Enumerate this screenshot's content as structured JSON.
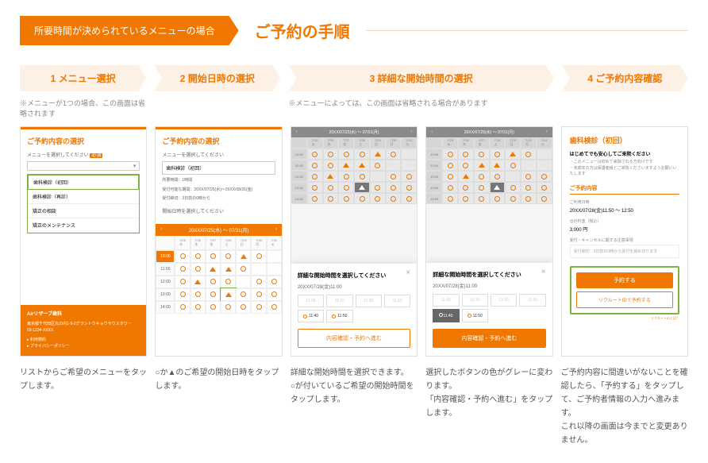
{
  "header": {
    "badge": "所要時間が決められているメニューの場合",
    "title": "ご予約の手順"
  },
  "steps": [
    {
      "num": "1",
      "label": "メニュー選択",
      "note": "※メニューが1つの場合、この画面は省略されます"
    },
    {
      "num": "2",
      "label": "開始日時の選択",
      "note": ""
    },
    {
      "num": "3",
      "label": "詳細な開始時間の選択",
      "note": "※メニューによっては、この画面は省略される場合があります",
      "wide": true
    },
    {
      "num": "4",
      "label": "ご予約内容確認",
      "note": ""
    }
  ],
  "mock1": {
    "title": "ご予約内容の選択",
    "label": "メニューを選択してください",
    "required": "必須",
    "items": [
      "歯科検診（初回）",
      "歯科検診（再診）",
      "矯正の相談",
      "矯正のメンテナンス"
    ],
    "clinic": "Airリザーブ歯科",
    "addr": "東京都千代田区丸の内1-9-2グラントウキョウサウスタワー",
    "tel": "03-1234-XXXX",
    "links": [
      "利用規約",
      "プライバシーポリシー"
    ]
  },
  "mock2": {
    "title": "ご予約内容の選択",
    "label": "メニューを選択してください",
    "menu": "歯科検診（初回）",
    "info": [
      "所要時間：1時間",
      "受付可能な期間：20XX/07/25(水)～20XX/08/31(金)",
      "受付締切：3日前の0時から"
    ],
    "cal_label": "開始日時を選択してください",
    "range": "20XX/07/25(水) ～ 07/31(月)",
    "days": [
      [
        "7/25",
        "水"
      ],
      [
        "7/26",
        "木"
      ],
      [
        "7/27",
        "金"
      ],
      [
        "7/28",
        "土"
      ],
      [
        "7/29",
        "日"
      ],
      [
        "7/30",
        "月"
      ],
      [
        "7/31",
        "火"
      ]
    ],
    "times": [
      "10:00",
      "11:00",
      "12:00",
      "13:00",
      "14:00"
    ]
  },
  "mock3": {
    "range": "20XX/07/25(水) ～ 07/31(月)",
    "modal_title": "詳細な開始時間を選択してください",
    "modal_date": "20XX/07/28(金)11:00",
    "slots": [
      "11:00",
      "11:10",
      "11:20",
      "11:30",
      "11:40",
      "11:50"
    ],
    "btn": "内容確認・予約へ進む"
  },
  "mock5": {
    "title": "歯科検診（初回）",
    "sub": "はじめてでも安心してご来院ください",
    "txt": "・このメニューは初めて来院される方向けです\n・未成年の方は保護者様とご来院くださいますようお願いいたします",
    "sec": "ご予約内容",
    "dt_lbl": "ご利用日時",
    "dt": "20XX/07/28(金)11:50 ～ 12:50",
    "price_lbl": "合計料金（税込）",
    "price": "3,000 円",
    "cancel_lbl": "受付・キャンセルに関する注意事項",
    "cancel": "受付締切　3日前の0時から受付を締め切ります",
    "b1": "予約する",
    "b2": "リクルートIDで予約する",
    "rec": "リクルートIDとは？"
  },
  "captions": [
    "リストからご希望のメニューをタップします。",
    "○か▲のご希望の開始日時をタップします。",
    "詳細な開始時間を選択できます。\n○が付いているご希望の開始時間をタップします。",
    "選択したボタンの色がグレーに変わります。\n「内容確認・予約へ進む」をタップします。",
    "ご予約内容に間違いがないことを確認したら、「予約する」をタップして、ご予約者情報の入力へ進みます。\nこれ以降の画面は今までと変更ありません。"
  ]
}
